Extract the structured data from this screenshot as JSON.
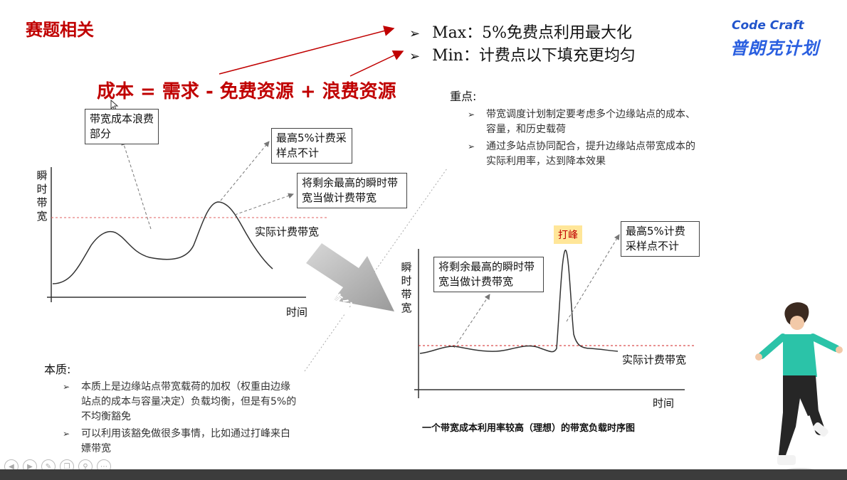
{
  "slide": {
    "title": "赛题相关",
    "formula": "成本 = 需求 - 免费资源 + 浪费资源",
    "goals": [
      {
        "marker": "➢",
        "text": "Max：5%免费点利用最大化"
      },
      {
        "marker": "➢",
        "text": "Min：计费点以下填充更均匀"
      }
    ]
  },
  "logo": {
    "top": "Code Craft",
    "bottom": "普朗克计划"
  },
  "key_points": {
    "title": "重点:",
    "items": [
      {
        "marker": "➢",
        "text": "带宽调度计划制定要考虑多个边缘站点的成本、容量，和历史载荷"
      },
      {
        "marker": "➢",
        "text": "通过多站点协同配合，提升边缘站点带宽成本的实际利用率，达到降本效果"
      }
    ]
  },
  "essence": {
    "title": "本质:",
    "items": [
      {
        "marker": "➢",
        "text": "本质上是边缘站点带宽载荷的加权（权重由边缘站点的成本与容量决定）负载均衡，但是有5%的不均衡豁免"
      },
      {
        "marker": "➢",
        "text": "可以利用该豁免做很多事情，比如通过打峰来白嫖带宽"
      }
    ]
  },
  "left_chart": {
    "ylabel": "瞬时带宽",
    "xlabel": "时间",
    "threshold_label": "实际计费带宽",
    "box_waste": "带宽成本浪费部分",
    "box_top5": "最高5%计费采样点不计",
    "box_remaining": "将剩余最高的瞬时带宽当做计费带宽"
  },
  "arrow_label": "削峰填谷",
  "right_chart": {
    "ylabel": "瞬时带宽",
    "xlabel": "时间",
    "threshold_label": "实际计费带宽",
    "box_remaining": "将剩余最高的瞬时带宽当做计费带宽",
    "box_top5": "最高5%计费采样点不计",
    "peak_tag": "打峰",
    "caption": "一个带宽成本利用率较高（理想）的带宽负载时序图"
  },
  "toolbar": {
    "icons": [
      "prev-icon",
      "next-icon",
      "pen-icon",
      "copy-icon",
      "zoom-icon",
      "more-icon"
    ]
  },
  "colors": {
    "accent": "#c00000",
    "threshold": "#e06060",
    "logo": "#2a5fe0"
  }
}
